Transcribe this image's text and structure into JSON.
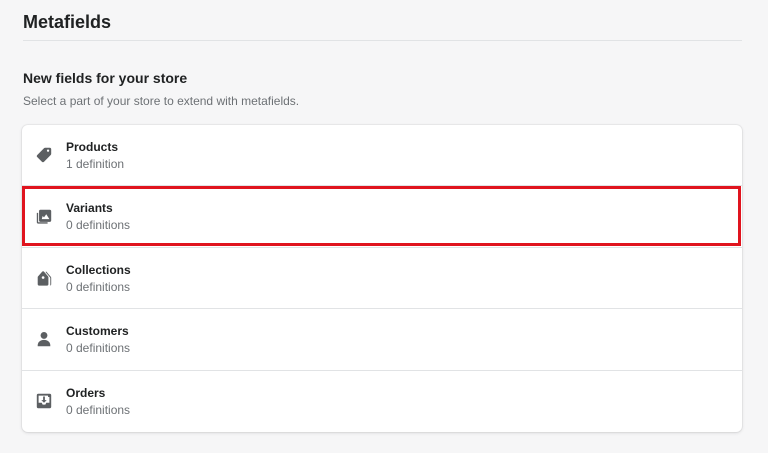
{
  "page": {
    "title": "Metafields"
  },
  "section": {
    "title": "New fields for your store",
    "subtitle": "Select a part of your store to extend with metafields."
  },
  "items": [
    {
      "label": "Products",
      "count": "1 definition",
      "icon": "tag-icon"
    },
    {
      "label": "Variants",
      "count": "0 definitions",
      "icon": "variants-icon"
    },
    {
      "label": "Collections",
      "count": "0 definitions",
      "icon": "collections-icon"
    },
    {
      "label": "Customers",
      "count": "0 definitions",
      "icon": "customer-icon"
    },
    {
      "label": "Orders",
      "count": "0 definitions",
      "icon": "orders-icon"
    }
  ],
  "colors": {
    "highlight": "#e0141e",
    "icon": "#5c5f62",
    "text": "#202223",
    "subdued": "#6d7175"
  }
}
